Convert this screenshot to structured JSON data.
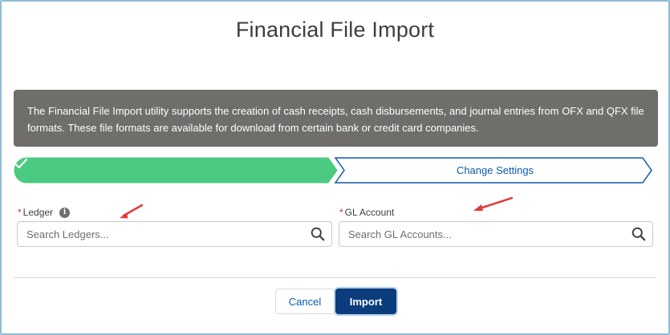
{
  "modal": {
    "title": "Financial File Import",
    "info_text": "The Financial File Import utility supports the creation of cash receipts, cash disbursements, and journal entries from OFX and QFX file formats. These file formats are available for download from certain bank or credit card companies."
  },
  "path": {
    "steps": [
      {
        "label": "",
        "status": "complete",
        "icon": "check-icon"
      },
      {
        "label": "Change Settings",
        "status": "current"
      }
    ],
    "colors": {
      "complete": "#4bca81",
      "current_border": "#0b5cab"
    }
  },
  "fields": {
    "ledger": {
      "required_mark": "*",
      "label": "Ledger",
      "placeholder": "Search Ledgers...",
      "info_icon": "i"
    },
    "gl_account": {
      "required_mark": "*",
      "label": "GL Account",
      "placeholder": "Search GL Accounts..."
    }
  },
  "footer": {
    "cancel_label": "Cancel",
    "import_label": "Import"
  },
  "colors": {
    "brand": "#0b3d7d",
    "required": "#c23934",
    "annotation_arrow": "#e53935"
  }
}
